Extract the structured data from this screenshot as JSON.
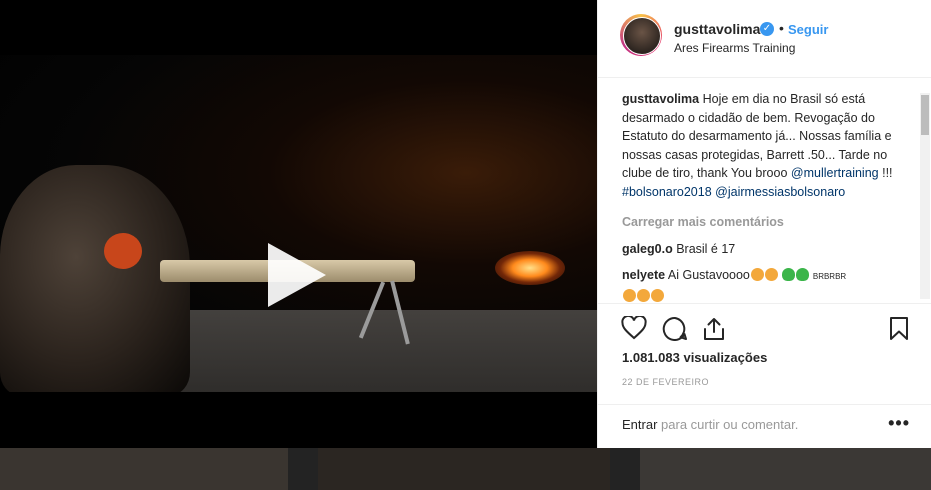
{
  "post": {
    "username": "gusttavolima",
    "follow_label": "Seguir",
    "separator": "•",
    "location": "Ares Firearms Training",
    "caption_user": "gusttavolima",
    "caption_text": "Hoje em dia no Brasil só está desarmado o cidadão de bem. Revogação do Estatuto do desarmamento já... Nossas família e nossas casas protegidas, Barrett .50... Tarde no clube de tiro, thank You brooo",
    "mention_1": "@mullertraining",
    "caption_mid": "!!!",
    "hashtag": "#bolsonaro2018",
    "mention_2": "@jairmessiasbolsonaro",
    "load_more": "Carregar mais comentários",
    "comments": [
      {
        "user": "galeg0.o",
        "text": "Brasil é 17"
      },
      {
        "user": "nelyete",
        "text": "Ai Gustavoooo",
        "suffix": "BRBRBR"
      }
    ],
    "views_count": "1.081.083",
    "views_label": "visualizações",
    "date": "22 DE FEVEREIRO",
    "login_link": "Entrar",
    "login_rest": "para curtir ou comentar.",
    "more_label": "•••"
  },
  "icons": {
    "like": "heart-icon",
    "comment": "comment-icon",
    "share": "share-icon",
    "save": "bookmark-icon",
    "verified": "verified-icon",
    "play": "play-icon"
  },
  "colors": {
    "link_blue": "#3897f0",
    "mention_blue": "#003569",
    "text": "#262626",
    "muted": "#999999"
  }
}
